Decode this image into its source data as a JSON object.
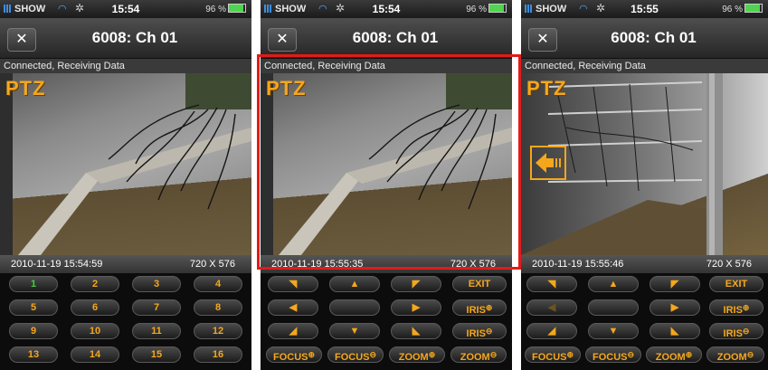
{
  "colors": {
    "accent_orange": "#f5a71c",
    "highlight_red": "#e41a1a",
    "key_green": "#3ed23e"
  },
  "screens": [
    {
      "status": {
        "carrier": "SHOW",
        "time": "15:54",
        "battery": "96 %"
      },
      "title": "6008: Ch 01",
      "close_label": "✕",
      "connection": "Connected, Receiving Data",
      "overlay": "PTZ",
      "timestamp": "2010-11-19 15:54:59",
      "resolution": "720 X 576",
      "keys": [
        "1",
        "2",
        "3",
        "4",
        "5",
        "6",
        "7",
        "8",
        "9",
        "10",
        "11",
        "12",
        "13",
        "14",
        "15",
        "16"
      ]
    },
    {
      "status": {
        "carrier": "SHOW",
        "time": "15:54",
        "battery": "96 %"
      },
      "title": "6008: Ch 01",
      "close_label": "✕",
      "connection": "Connected, Receiving Data",
      "overlay": "PTZ",
      "timestamp": "2010-11-19 15:55:35",
      "resolution": "720 X 576",
      "ptz_labels": {
        "exit": "EXIT",
        "iris": "IRIS",
        "focus": "FOCUS",
        "zoom": "ZOOM",
        "plus": "⊕",
        "minus": "⊖"
      }
    },
    {
      "status": {
        "carrier": "SHOW",
        "time": "15:55",
        "battery": "96 %"
      },
      "title": "6008: Ch 01",
      "close_label": "✕",
      "connection": "Connected, Receiving Data",
      "overlay": "PTZ",
      "timestamp": "2010-11-19 15:55:46",
      "resolution": "720 X 576",
      "ptz_labels": {
        "exit": "EXIT",
        "iris": "IRIS",
        "focus": "FOCUS",
        "zoom": "ZOOM",
        "plus": "⊕",
        "minus": "⊖"
      }
    }
  ]
}
